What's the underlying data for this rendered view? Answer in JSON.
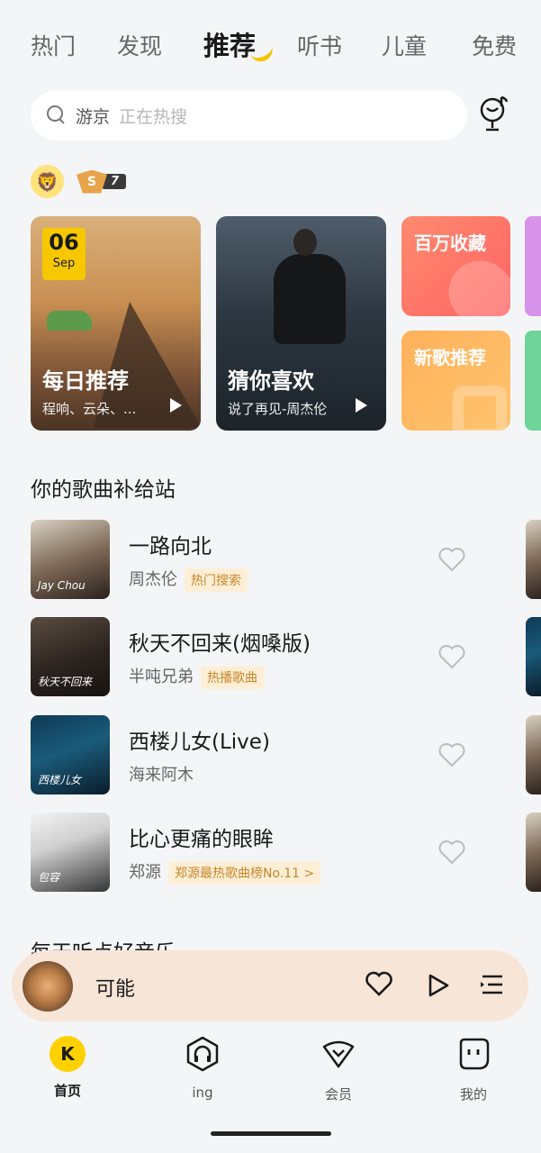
{
  "tabs": [
    "热门",
    "发现",
    "推荐",
    "听书",
    "儿童",
    "免费"
  ],
  "active_tab_index": 2,
  "search": {
    "keyword": "游京",
    "hint": "正在热搜"
  },
  "badges": {
    "level_letter": "S",
    "level_number": "7"
  },
  "cards": {
    "daily": {
      "date_day": "06",
      "date_month": "Sep",
      "title": "每日推荐",
      "subtitle": "程响、云朵、..."
    },
    "guess": {
      "title": "猜你喜欢",
      "subtitle": "说了再见-周杰伦"
    },
    "million": {
      "title": "百万收藏"
    },
    "new_songs": {
      "title": "新歌推荐"
    }
  },
  "section_title": "你的歌曲补给站",
  "songs": [
    {
      "title": "一路向北",
      "artist": "周杰伦",
      "tag": "热门搜索",
      "cover_text": "Jay Chou"
    },
    {
      "title": "秋天不回来(烟嗓版)",
      "artist": "半吨兄弟",
      "tag": "热播歌曲",
      "cover_text": "秋天不回来"
    },
    {
      "title": "西楼儿女(Live)",
      "artist": "海来阿木",
      "tag": "",
      "cover_text": "西楼儿女"
    },
    {
      "title": "比心更痛的眼眸",
      "artist": "郑源",
      "tag": "郑源最热歌曲榜No.11 >",
      "cover_text": "包容"
    }
  ],
  "section2_title": "每天听点好音乐",
  "player": {
    "title": "可能"
  },
  "nav": [
    {
      "label": "首页",
      "icon": "k-logo-icon"
    },
    {
      "label": "ing",
      "icon": "headphone-icon"
    },
    {
      "label": "会员",
      "icon": "vip-heart-icon"
    },
    {
      "label": "我的",
      "icon": "profile-face-icon"
    }
  ],
  "colors": {
    "accent": "#FFD100",
    "background": "#F4F5F7",
    "player_bg": "#F7E5D7",
    "tag_bg": "#FDEFD6",
    "tag_text": "#C7862B"
  }
}
